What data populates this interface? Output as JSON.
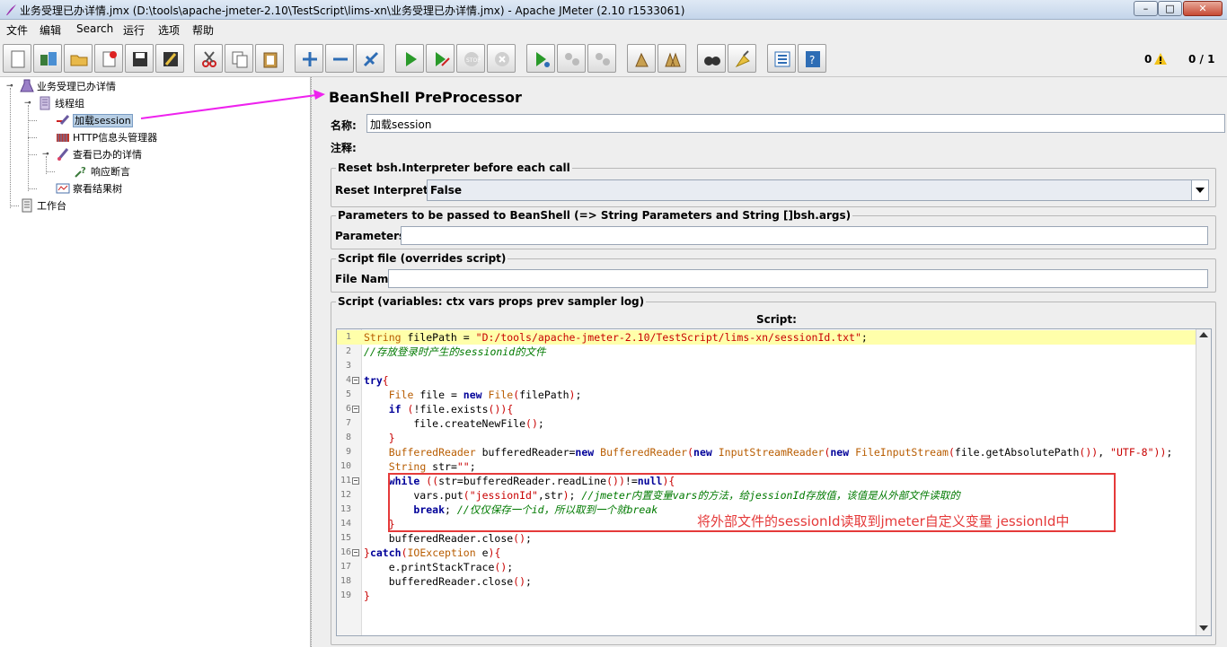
{
  "window": {
    "title": "业务受理已办详情.jmx (D:\\tools\\apache-jmeter-2.10\\TestScript\\lims-xn\\业务受理已办详情.jmx) - Apache JMeter (2.10 r1533061)",
    "controls": {
      "minimize": "–",
      "maximize": "□",
      "close": "✕"
    }
  },
  "menu": [
    "文件",
    "编辑",
    "Search",
    "运行",
    "选项",
    "帮助"
  ],
  "toolbar": {
    "warning_count": "0",
    "thread_status": "0 / 1",
    "buttons": [
      "new-icon",
      "templates-icon",
      "open-icon",
      "close-icon",
      "save-icon",
      "save-as-icon",
      "cut-icon",
      "copy-icon",
      "paste-icon",
      "expand-icon",
      "collapse-icon",
      "toggle-icon",
      "start-icon",
      "start-no-pause-icon",
      "stop-icon",
      "shutdown-icon",
      "remote-start-icon",
      "remote-stop-icon",
      "remote-shutdown-icon",
      "clear-icon",
      "clear-all-icon",
      "search-icon",
      "reset-search-icon",
      "function-helper-icon",
      "help-icon"
    ]
  },
  "tree": {
    "nodes": [
      {
        "label": "业务受理已办详情",
        "icon": "test-plan-icon",
        "level": 0
      },
      {
        "label": "线程组",
        "icon": "thread-group-icon",
        "level": 1
      },
      {
        "label": "加载session",
        "icon": "preprocessor-icon",
        "level": 2,
        "selected": true
      },
      {
        "label": "HTTP信息头管理器",
        "icon": "header-manager-icon",
        "level": 2
      },
      {
        "label": "查看已办的详情",
        "icon": "sampler-icon",
        "level": 2
      },
      {
        "label": "响应断言",
        "icon": "assertion-icon",
        "level": 3
      },
      {
        "label": "察看结果树",
        "icon": "listener-icon",
        "level": 2
      },
      {
        "label": "工作台",
        "icon": "workbench-icon",
        "level": 0
      }
    ]
  },
  "panel": {
    "title": "BeanShell PreProcessor",
    "name_label": "名称:",
    "name_value": "加载session",
    "comment_label": "注释:",
    "reset_group": {
      "legend": "Reset bsh.Interpreter before each call",
      "label": "Reset Interpreter:",
      "value": "False"
    },
    "params_group": {
      "legend": "Parameters to be passed to BeanShell (=> String Parameters and String []bsh.args)",
      "label": "Parameters:",
      "value": ""
    },
    "file_group": {
      "legend": "Script file (overrides script)",
      "label": "File Name:",
      "value": ""
    },
    "script_group": {
      "legend": "Script (variables: ctx vars props prev sampler log)",
      "header": "Script:"
    }
  },
  "script_lines": [
    "String filePath = \"D:/tools/apache-jmeter-2.10/TestScript/lims-xn/sessionId.txt\";",
    "//存放登录时产生的sessionid的文件",
    "",
    "try{",
    "    File file = new File(filePath);",
    "    if (!file.exists()){",
    "        file.createNewFile();",
    "    }",
    "    BufferedReader bufferedReader=new BufferedReader(new InputStreamReader(new FileInputStream(file.getAbsolutePath()), \"UTF-8\"));",
    "    String str=\"\";",
    "    while ((str=bufferedReader.readLine())!=null){",
    "        vars.put(\"jessionId\",str); //jmeter内置变量vars的方法，给jessionId存放值，该值是从外部文件读取的",
    "        break; //仅仅保存一个id，所以取到一个就break",
    "    }",
    "    bufferedReader.close();",
    "}catch(IOException e){",
    "    e.printStackTrace();",
    "    bufferedReader.close();",
    "}"
  ],
  "annotation": {
    "note": "将外部文件的sessionId读取到jmeter自定义变量 jessionId中",
    "box_color": "#e53a3a",
    "arrow_color": "#ee22ee"
  }
}
